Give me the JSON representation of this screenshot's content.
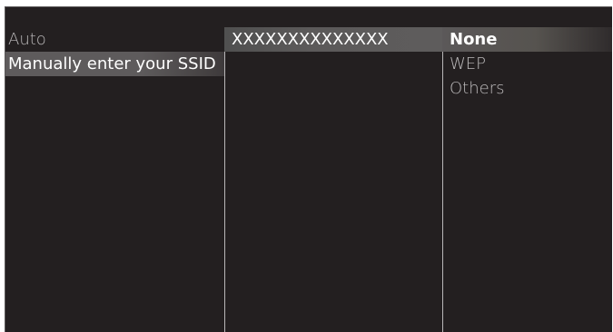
{
  "left_menu": {
    "items": [
      {
        "label": "Auto"
      },
      {
        "label": "Manually enter your SSID"
      }
    ],
    "selected_index": 1
  },
  "middle_panel": {
    "ssid_value": "XXXXXXXXXXXXXX"
  },
  "right_menu": {
    "items": [
      {
        "label": "None"
      },
      {
        "label": "WEP"
      },
      {
        "label": "Others"
      }
    ],
    "selected_index": 0
  },
  "colors": {
    "background": "#231f20",
    "highlight": "#5e5b5c",
    "text": "#ffffff",
    "divider": "#b9b7b8"
  }
}
